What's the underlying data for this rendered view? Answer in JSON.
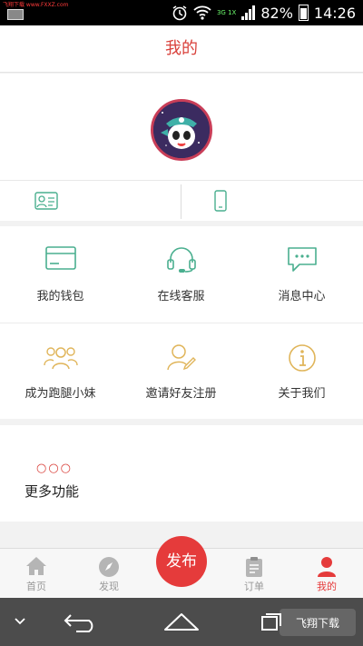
{
  "status_bar": {
    "watermark": "飞翔下载 www.FXXZ.com",
    "battery": "82%",
    "time": "14:26",
    "network": "3G 1X"
  },
  "header": {
    "title": "我的"
  },
  "grid": [
    {
      "label": "我的钱包",
      "icon": "wallet-icon"
    },
    {
      "label": "在线客服",
      "icon": "headset-icon"
    },
    {
      "label": "消息中心",
      "icon": "chat-bubble-icon"
    },
    {
      "label": "成为跑腿小妹",
      "icon": "people-icon"
    },
    {
      "label": "邀请好友注册",
      "icon": "user-edit-icon"
    },
    {
      "label": "关于我们",
      "icon": "info-icon"
    }
  ],
  "more": {
    "dots": "○○○",
    "label": "更多功能"
  },
  "tabbar": {
    "home": "首页",
    "discover": "发现",
    "publish": "发布",
    "orders": "订单",
    "mine": "我的"
  },
  "nav_watermark": "飞翔下载",
  "colors": {
    "accent": "#d9413b",
    "green": "#4aaf8f",
    "gold": "#e0b55a",
    "tab_inactive": "#999999"
  }
}
